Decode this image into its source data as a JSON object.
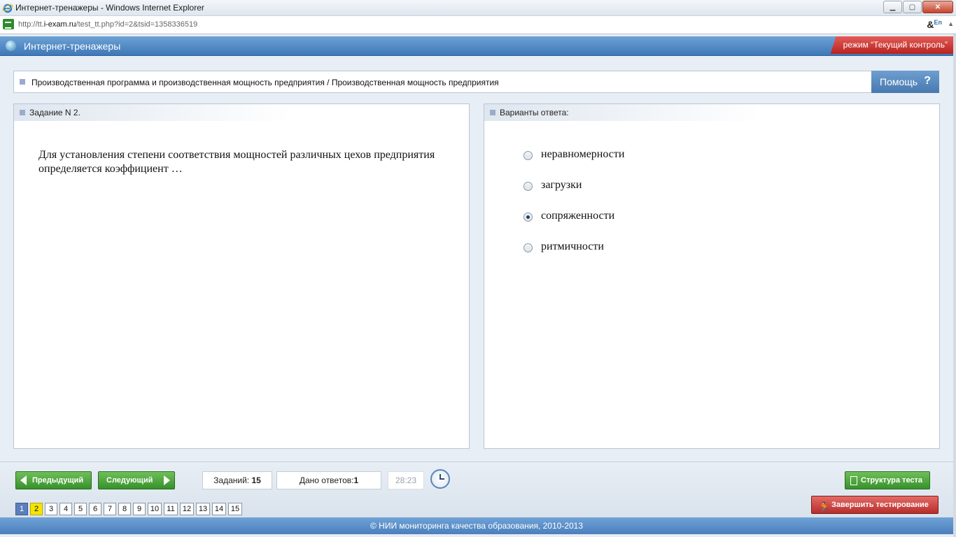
{
  "window": {
    "title": "Интернет-тренажеры - Windows Internet Explorer",
    "controls": {
      "minimize": "▁",
      "maximize": "▢",
      "close": "✕"
    }
  },
  "address": {
    "url_prefix": "http://tt.",
    "url_host": "i-exam.ru",
    "url_path": "/test_tt.php?id=2&tsid=1358336519",
    "lang_symbol": "&",
    "lang_code": "En"
  },
  "app": {
    "title": "Интернет-тренажеры",
    "mode": "режим “Текущий контроль”"
  },
  "breadcrumb": "Производственная программа и производственная мощность предприятия / Производственная мощность предприятия",
  "help": {
    "label": "Помощь",
    "icon_glyph": "?"
  },
  "question_panel": {
    "title": "Задание N 2.",
    "text": "Для установления степени соответствия мощностей различных цехов предприятия определяется коэффициент …"
  },
  "answers_panel": {
    "title": "Варианты ответа:",
    "options": [
      {
        "label": "неравномерности",
        "selected": false
      },
      {
        "label": "загрузки",
        "selected": false
      },
      {
        "label": "сопряженности",
        "selected": true
      },
      {
        "label": "ритмичности",
        "selected": false
      }
    ]
  },
  "footer": {
    "prev_label": "Предыдущий",
    "next_label": "Следующий",
    "tasks_label": "Заданий:",
    "tasks_count": "15",
    "answers_label": "Дано ответов:",
    "answers_count": "1",
    "timer": "28:23",
    "structure_label": "Структура теста",
    "finish_label": "Завершить тестирование",
    "pages": [
      "1",
      "2",
      "3",
      "4",
      "5",
      "6",
      "7",
      "8",
      "9",
      "10",
      "11",
      "12",
      "13",
      "14",
      "15"
    ],
    "current_page": "1",
    "answered_pages": [
      "2"
    ]
  },
  "copyright": "© НИИ мониторинга качества образования, 2010-2013",
  "colors": {
    "header_blue": "#4f86c3",
    "mode_red": "#c93632",
    "button_green": "#4aa33b",
    "finish_red": "#c9403c",
    "page_current": "#5b7fba",
    "page_answered": "#f6e400"
  }
}
